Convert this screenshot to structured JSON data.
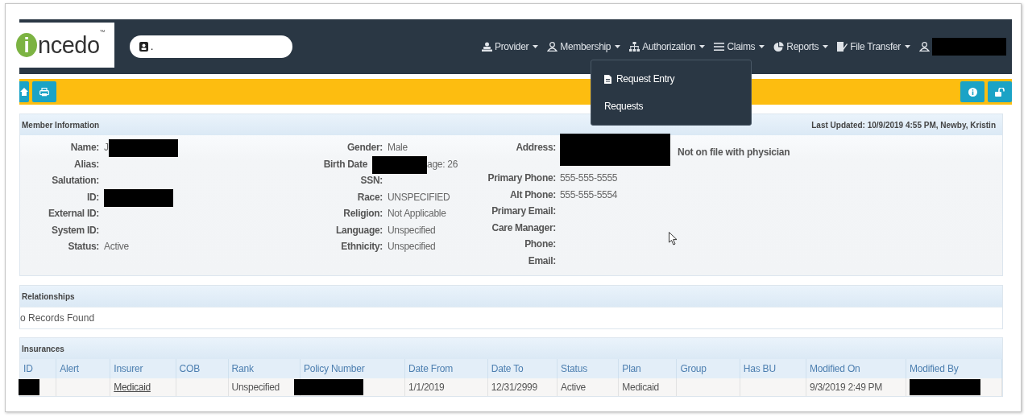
{
  "logo": {
    "mark": "i",
    "text": "ncedo",
    "tm": "™"
  },
  "search": {
    "value": "."
  },
  "nav": [
    {
      "kind": "menu",
      "label": "Provider"
    },
    {
      "kind": "menu",
      "label": "Membership"
    },
    {
      "kind": "menu",
      "label": "Authorization"
    },
    {
      "kind": "menu",
      "label": "Claims"
    },
    {
      "kind": "menu",
      "label": "Reports"
    },
    {
      "kind": "menu",
      "label": "File Transfer"
    },
    {
      "kind": "user",
      "redacted": true
    }
  ],
  "dropdown": {
    "items": [
      {
        "label": "Request Entry"
      },
      {
        "label": "Requests"
      }
    ]
  },
  "member": {
    "title": "Member Information",
    "last_updated": "Last Updated: 10/9/2019 4:55 PM, Newby, Kristin",
    "columns": [
      [
        {
          "label": "Name:",
          "value": "J",
          "redacted": true
        },
        {
          "label": "Alias:"
        },
        {
          "label": "Salutation:"
        },
        {
          "label": "ID:",
          "redacted": true
        },
        {
          "label": "External ID:"
        },
        {
          "label": "System ID:"
        },
        {
          "label": "Status:",
          "value": "Active"
        }
      ],
      [
        {
          "label": "Gender:",
          "value": "Male"
        },
        {
          "label": "Birth Date",
          "redacted": true,
          "after": "age: 26"
        },
        {
          "label": "SSN:"
        },
        {
          "label": "Race:",
          "value": "UNSPECIFIED"
        },
        {
          "label": "Religion:",
          "value": "Not Applicable"
        },
        {
          "label": "Language:",
          "value": "Unspecified"
        },
        {
          "label": "Ethnicity:",
          "value": "Unspecified"
        }
      ],
      [
        {
          "label": "Address:",
          "redacted": true,
          "tall": true
        },
        {
          "label": "Primary Phone:",
          "value": "555-555-5555"
        },
        {
          "label": "Alt Phone:",
          "value": "555-555-5554"
        },
        {
          "label": "Primary Email:"
        },
        {
          "label": "Care Manager:"
        },
        {
          "label": "Phone:"
        },
        {
          "label": "Email:"
        }
      ]
    ],
    "note": "Not on file with physician"
  },
  "relationships": {
    "title": "Relationships",
    "empty": "o Records Found"
  },
  "insurances": {
    "title": "Insurances",
    "columns": [
      "ID",
      "Alert",
      "Insurer",
      "COB",
      "Rank",
      "Policy Number",
      "Date From",
      "Date To",
      "Status",
      "Plan",
      "Group",
      "Has BU",
      "Modified On",
      "Modified By"
    ],
    "rows": [
      [
        {
          "kind": "redacted"
        },
        {
          "kind": "empty"
        },
        {
          "kind": "link",
          "text": "Medicaid"
        },
        {
          "kind": "empty"
        },
        {
          "kind": "text",
          "text": "Unspecified"
        },
        {
          "kind": "redacted"
        },
        {
          "kind": "text",
          "text": "1/1/2019"
        },
        {
          "kind": "text",
          "text": "12/31/2999"
        },
        {
          "kind": "text",
          "text": "Active"
        },
        {
          "kind": "text",
          "text": "Medicaid"
        },
        {
          "kind": "empty"
        },
        {
          "kind": "empty"
        },
        {
          "kind": "text",
          "text": "9/3/2019 2:49 PM"
        },
        {
          "kind": "redacted"
        }
      ]
    ]
  }
}
